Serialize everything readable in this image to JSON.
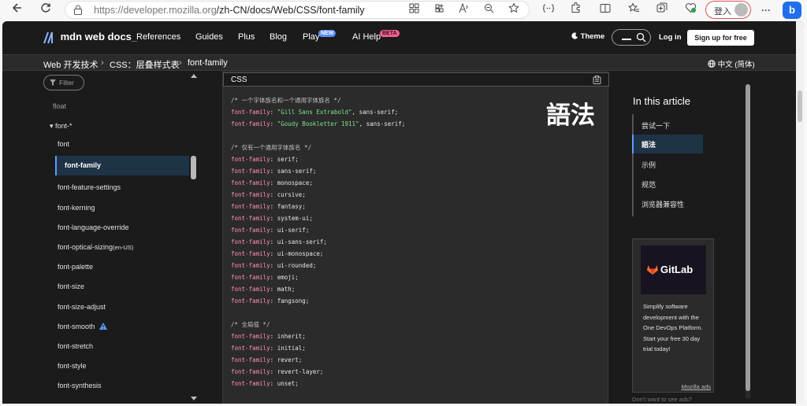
{
  "browser": {
    "url_host": "https://developer.mozilla.org",
    "url_path": "/zh-CN/docs/Web/CSS/font-family",
    "profile_label": "登入",
    "toolbar_icons": [
      "back-icon",
      "refresh-icon",
      "lock-icon",
      "grid-icon",
      "app-icon",
      "read-aloud-icon",
      "zoom-icon",
      "favorite-icon",
      "code-icon",
      "extensions-icon",
      "split-icon",
      "favorites-icon",
      "collections-icon",
      "health-icon",
      "more-icon",
      "bing-icon"
    ]
  },
  "header": {
    "logo_text": "mdn web docs",
    "nav": {
      "references": "References",
      "guides": "Guides",
      "plus": "Plus",
      "blog": "Blog",
      "play": "Play",
      "play_badge": "NEW",
      "ai_help": "AI Help",
      "ai_badge": "BETA"
    },
    "theme": "Theme",
    "login": "Log in",
    "signup": "Sign up for free"
  },
  "breadcrumb": {
    "items": [
      "Web 开发技术",
      "CSS：层叠样式表",
      "font-family"
    ],
    "separator": "›",
    "language": "中文 (简体)"
  },
  "sidebar": {
    "filter_placeholder": "Filter",
    "items": {
      "float": "float",
      "font_group": "▾ font-*",
      "font": "font",
      "active": "font-family",
      "i1": "font-feature-settings",
      "i2": "font-kerning",
      "i3": "font-language-override",
      "i4": "font-optical-sizing",
      "i4_suffix": "(en-US)",
      "i5": "font-palette",
      "i6": "font-size",
      "i7": "font-size-adjust",
      "i8": "font-smooth",
      "i9": "font-stretch",
      "i10": "font-style",
      "i11": "font-synthesis"
    }
  },
  "code": {
    "language": "CSS",
    "heading": "語法",
    "comments": {
      "c1": "/* 一个字体族名和一个通用字体族名 */",
      "c2": "/* 仅有一个通用字体族名 */",
      "c3": "/* 全局值 */"
    },
    "prop": "font-family",
    "strings": {
      "s1": "\"Gill Sans Extrabold\"",
      "s2": "\"Goudy Bookletter 1911\""
    },
    "values": [
      "sans-serif",
      "serif",
      "sans-serif",
      "monospace",
      "cursive",
      "fantasy",
      "system-ui",
      "ui-serif",
      "ui-sans-serif",
      "ui-monospace",
      "ui-rounded",
      "emoji",
      "math",
      "fangsong",
      "inherit",
      "initial",
      "revert",
      "revert-layer",
      "unset"
    ]
  },
  "toc": {
    "title": "In this article",
    "items": [
      "尝试一下",
      "語法",
      "示例",
      "规范",
      "浏览器兼容性"
    ]
  },
  "ad": {
    "brand": "GitLab",
    "text": "Simplify software development with the One DevOps Platform. Start your free 30 day trial today!",
    "label": "Mozilla ads",
    "footer": "Don't want to see ads?"
  }
}
